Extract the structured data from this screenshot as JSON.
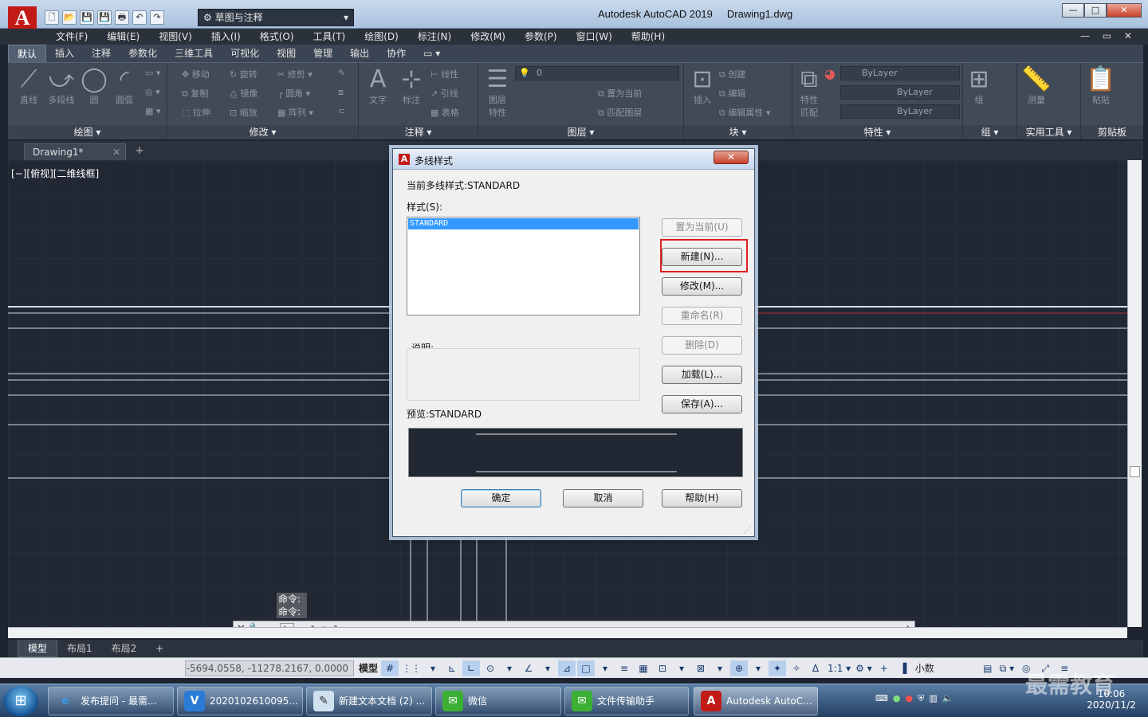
{
  "app": {
    "logo": "A",
    "title": "Autodesk AutoCAD 2019",
    "drawing_name": "Drawing1.dwg",
    "workspace": "草图与注释",
    "window_buttons": [
      "—",
      "□",
      "✕"
    ],
    "mdi_buttons": "— ▭ ✕"
  },
  "quick_access": [
    "🗋",
    "📂",
    "💾",
    "💾",
    "🖶",
    "↶",
    "↷"
  ],
  "menubar": [
    "文件(F)",
    "编辑(E)",
    "视图(V)",
    "插入(I)",
    "格式(O)",
    "工具(T)",
    "绘图(D)",
    "标注(N)",
    "修改(M)",
    "参数(P)",
    "窗口(W)",
    "帮助(H)"
  ],
  "ribbon_tabs": [
    "默认",
    "插入",
    "注释",
    "参数化",
    "三维工具",
    "可视化",
    "视图",
    "管理",
    "输出",
    "协作",
    "▭ ▾"
  ],
  "ribbon": {
    "draw": {
      "title": "绘图 ▾",
      "line": "直线",
      "polyline": "多段线",
      "circle": "圆",
      "arc": "圆弧"
    },
    "modify": {
      "title": "修改 ▾",
      "move": "移动",
      "rotate": "旋转",
      "trim": "修剪",
      "copy": "复制",
      "mirror": "镜像",
      "fillet": "圆角",
      "stretch": "拉伸",
      "scale": "缩放",
      "array": "阵列"
    },
    "annotation": {
      "title": "注释 ▾",
      "text": "文字",
      "dimension": "标注",
      "linear": "线性",
      "leader": "引线",
      "table": "表格"
    },
    "layers": {
      "title": "图层 ▾",
      "layer_props": "图层\n特性",
      "current_layer": "0",
      "make_current": "置为当前",
      "match_layer": "匹配图层"
    },
    "block": {
      "title": "块 ▾",
      "insert": "插入",
      "create": "创建",
      "edit": "编辑",
      "edit_attr": "编辑属性"
    },
    "properties": {
      "title": "特性 ▾",
      "match": "特性\n匹配",
      "color": "ByLayer",
      "linetype": "ByLayer",
      "lineweight": "ByLayer"
    },
    "groups": {
      "title": "组 ▾",
      "group": "组"
    },
    "utilities": {
      "title": "实用工具 ▾",
      "measure": "测量"
    },
    "clipboard": {
      "title": "剪贴板",
      "paste": "粘贴"
    }
  },
  "doc_tab": {
    "name": "Drawing1*",
    "close": "✕",
    "add": "+"
  },
  "viewport_label": "[−][俯视][二维线框]",
  "command": {
    "history": [
      "命令:",
      "命令:"
    ],
    "input": "_mlstyle",
    "close": "✕ 🔧",
    "prompt_icon": "▶"
  },
  "layout_tabs": [
    "模型",
    "布局1",
    "布局2",
    "+"
  ],
  "status": {
    "coords": "-5694.0558, -11278.2167, 0.0000",
    "model": "模型",
    "icons": [
      "#",
      "⋮⋮",
      "▾",
      "⊾",
      "∟",
      "⊙",
      "▾",
      "∠",
      "▾",
      "⊿",
      "□",
      "▾",
      "≡",
      "▦",
      "⊡",
      "▾",
      "⊠",
      "▾",
      "⊕",
      "▾",
      "✦",
      "✧",
      "ᐃ"
    ],
    "scale": "1:1 ▾",
    "units": "小数"
  },
  "taskbar": {
    "start": "⊞",
    "items": [
      {
        "label": "发布提问 - 最需...",
        "icon": "e"
      },
      {
        "label": "2020102610095...",
        "icon": "V"
      },
      {
        "label": "新建文本文档 (2) ...",
        "icon": "✎"
      },
      {
        "label": "微信",
        "icon": "✉"
      },
      {
        "label": "文件传输助手",
        "icon": "✉"
      },
      {
        "label": "Autodesk AutoC...",
        "icon": "A"
      }
    ],
    "clock_time": "10:06",
    "clock_date": "2020/11/2",
    "watermark": "最需教育"
  },
  "dialog": {
    "title": "多线样式",
    "icon": "A",
    "close": "✕",
    "current_style_label": "当前多线样式:STANDARD",
    "styles_label": "样式(S):",
    "styles": [
      "STANDARD"
    ],
    "description_label": "说明:",
    "preview_label": "预览:STANDARD",
    "buttons": {
      "set_current": "置为当前(U)",
      "new": "新建(N)...",
      "modify": "修改(M)...",
      "rename": "重命名(R)",
      "delete": "删除(D)",
      "load": "加载(L)...",
      "save": "保存(A)...",
      "ok": "确定",
      "cancel": "取消",
      "help": "帮助(H)"
    }
  },
  "colors": {
    "canvas": "#212833",
    "highlight": "#e02020",
    "selection": "#3399ff",
    "ribbon": "#414a57"
  }
}
